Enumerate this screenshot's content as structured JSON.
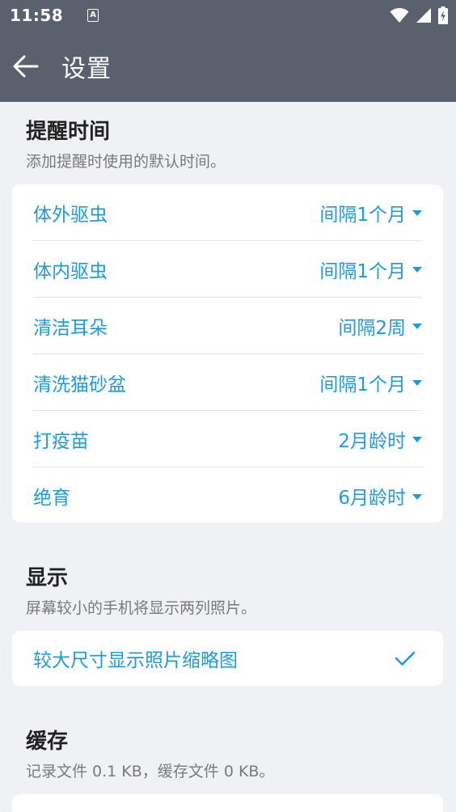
{
  "status_bar": {
    "time": "11:58",
    "notification_icon": "a-badge-icon",
    "icons": [
      "wifi-icon",
      "signal-icon",
      "battery-charging-icon"
    ]
  },
  "app_bar": {
    "title": "设置",
    "back_icon": "arrow-back-icon"
  },
  "reminder": {
    "title": "提醒时间",
    "desc": "添加提醒时使用的默认时间。",
    "items": [
      {
        "label": "体外驱虫",
        "value": "间隔1个月"
      },
      {
        "label": "体内驱虫",
        "value": "间隔1个月"
      },
      {
        "label": "清洁耳朵",
        "value": "间隔2周"
      },
      {
        "label": "清洗猫砂盆",
        "value": "间隔1个月"
      },
      {
        "label": "打疫苗",
        "value": "2月龄时"
      },
      {
        "label": "绝育",
        "value": "6月龄时"
      }
    ]
  },
  "display": {
    "title": "显示",
    "desc": "屏幕较小的手机将显示两列照片。",
    "option_label": "较大尺寸显示照片缩略图",
    "option_checked": true
  },
  "cache": {
    "title": "缓存",
    "desc": "记录文件 0.1 KB，缓存文件 0 KB。"
  },
  "colors": {
    "app_bar": "#59616f",
    "accent": "#1e9bd7",
    "background": "#f0f1f5"
  }
}
